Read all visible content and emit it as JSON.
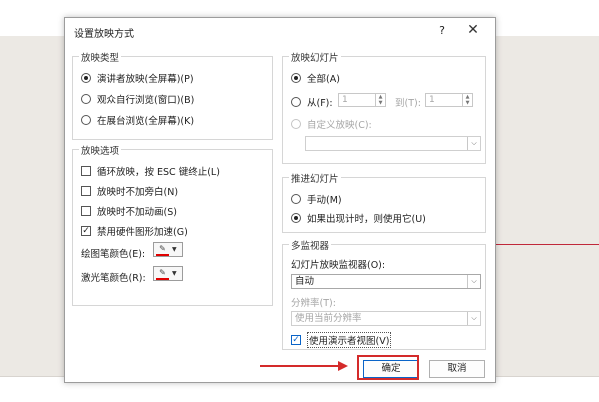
{
  "dialog": {
    "title": "设置放映方式",
    "help": "?",
    "close": "✕"
  },
  "show_type": {
    "label": "放映类型",
    "options": [
      {
        "label": "演讲者放映(全屏幕)(P)",
        "selected": true
      },
      {
        "label": "观众自行浏览(窗口)(B)",
        "selected": false
      },
      {
        "label": "在展台浏览(全屏幕)(K)",
        "selected": false
      }
    ]
  },
  "show_options": {
    "label": "放映选项",
    "checkboxes": [
      {
        "label": "循环放映，按 ESC 键终止(L)",
        "checked": false
      },
      {
        "label": "放映时不加旁白(N)",
        "checked": false
      },
      {
        "label": "放映时不加动画(S)",
        "checked": false
      },
      {
        "label": "禁用硬件图形加速(G)",
        "checked": true
      }
    ],
    "pen_color_label": "绘图笔颜色(E):",
    "laser_color_label": "激光笔颜色(R):",
    "pen_color": "#e00000",
    "laser_color": "#e00000"
  },
  "show_slides": {
    "label": "放映幻灯片",
    "all_label": "全部(A)",
    "from_label": "从(F):",
    "from_value": "1",
    "to_label": "到(T):",
    "to_value": "1",
    "custom_label": "自定义放映(C):"
  },
  "advance": {
    "label": "推进幻灯片",
    "manual_label": "手动(M)",
    "timing_label": "如果出现计时，则使用它(U)"
  },
  "monitors": {
    "label": "多监视器",
    "monitor_label": "幻灯片放映监视器(O):",
    "monitor_value": "自动",
    "resolution_label": "分辨率(T):",
    "resolution_value": "使用当前分辨率",
    "presenter_view_label": "使用演示者视图(V)",
    "presenter_view_checked": true
  },
  "buttons": {
    "ok": "确定",
    "cancel": "取消"
  },
  "colors": {
    "highlight": "#d42a2a",
    "accent": "#0a64c8"
  }
}
